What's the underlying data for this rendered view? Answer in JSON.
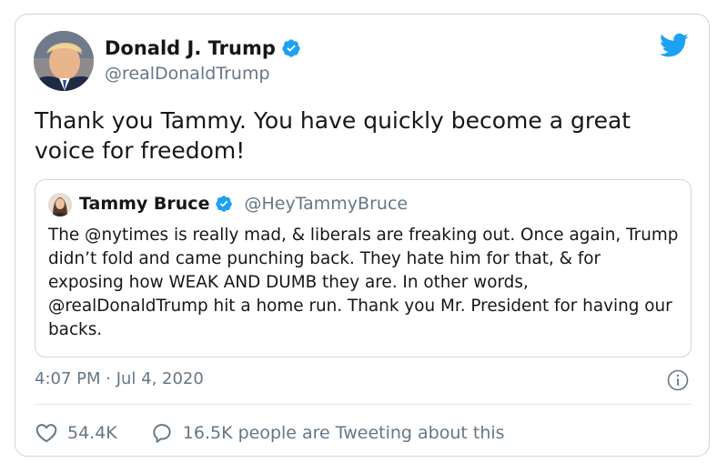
{
  "tweet": {
    "author_name": "Donald J. Trump",
    "handle": "@realDonaldTrump",
    "verified_icon": "verified-badge-icon",
    "brand_icon": "twitter-bird-icon",
    "text": "Thank you Tammy. You have quickly become a great voice for freedom!",
    "timestamp": "4:07 PM · Jul 4, 2020",
    "info_icon": "info-icon"
  },
  "quoted_tweet": {
    "author_name": "Tammy Bruce",
    "handle": "@HeyTammyBruce",
    "verified_icon": "verified-badge-icon",
    "text": "The @nytimes is really mad, & liberals are freaking out. Once again, Trump didn’t fold and came punching back. They hate him for that, & for exposing how WEAK AND DUMB they are. In other words, @realDonaldTrump hit a home run. Thank you Mr. President for having our backs."
  },
  "actions": {
    "likes": "54.4K",
    "like_icon": "heart-icon",
    "tweeting": "16.5K people are Tweeting about this",
    "reply_icon": "speech-bubble-icon"
  },
  "colors": {
    "accent": "#1da1f2",
    "secondary_text": "#657786",
    "border": "#ccd6dd"
  }
}
